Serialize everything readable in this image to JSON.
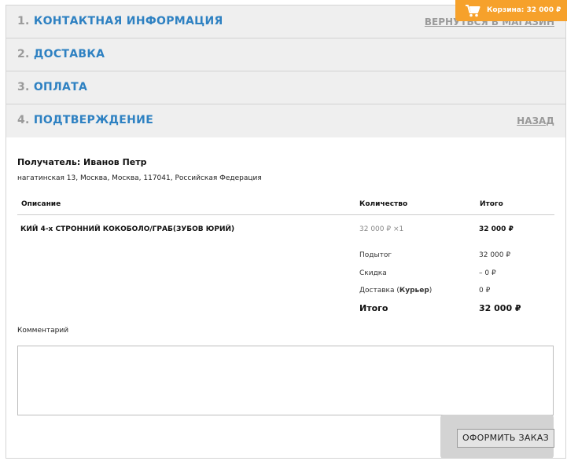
{
  "steps": [
    {
      "num": "1.",
      "label": "КОНТАКТНАЯ ИНФОРМАЦИЯ",
      "link": "ВЕРНУТЬСЯ В МАГАЗИН"
    },
    {
      "num": "2.",
      "label": "ДОСТАВКА"
    },
    {
      "num": "3.",
      "label": "ОПЛАТА"
    },
    {
      "num": "4.",
      "label": "ПОДТВЕРЖДЕНИЕ",
      "link": "НАЗАД"
    }
  ],
  "cart": {
    "label": "Корзина: 32 000 ₽",
    "icon": "cart-icon"
  },
  "confirmation": {
    "recipient": "Получатель: Иванов Петр",
    "address": "нагатинская 13, Москва, Москва, 117041, Российская Федерация",
    "table": {
      "headers": {
        "description": "Описание",
        "quantity": "Количество",
        "total": "Итого"
      },
      "items": [
        {
          "name": "КИЙ 4-х СТРОННИЙ КОКОБОЛО/ГРАБ(ЗУБОВ ЮРИЙ)",
          "price_qty": "32 000 ₽ ×1",
          "total": "32 000 ₽"
        }
      ],
      "summary": {
        "subtotal_label": "Подытог",
        "subtotal_value": "32 000 ₽",
        "discount_label": "Скидка",
        "discount_value": "– 0 ₽",
        "delivery_label_prefix": "Доставка (",
        "delivery_method": "Курьер",
        "delivery_label_suffix": ")",
        "delivery_value": "0 ₽",
        "grand_label": "Итого",
        "grand_value": "32 000 ₽"
      }
    },
    "comment_label": "Комментарий",
    "comment_value": "",
    "submit_label": "ОФОРМИТЬ ЗАКАЗ"
  }
}
